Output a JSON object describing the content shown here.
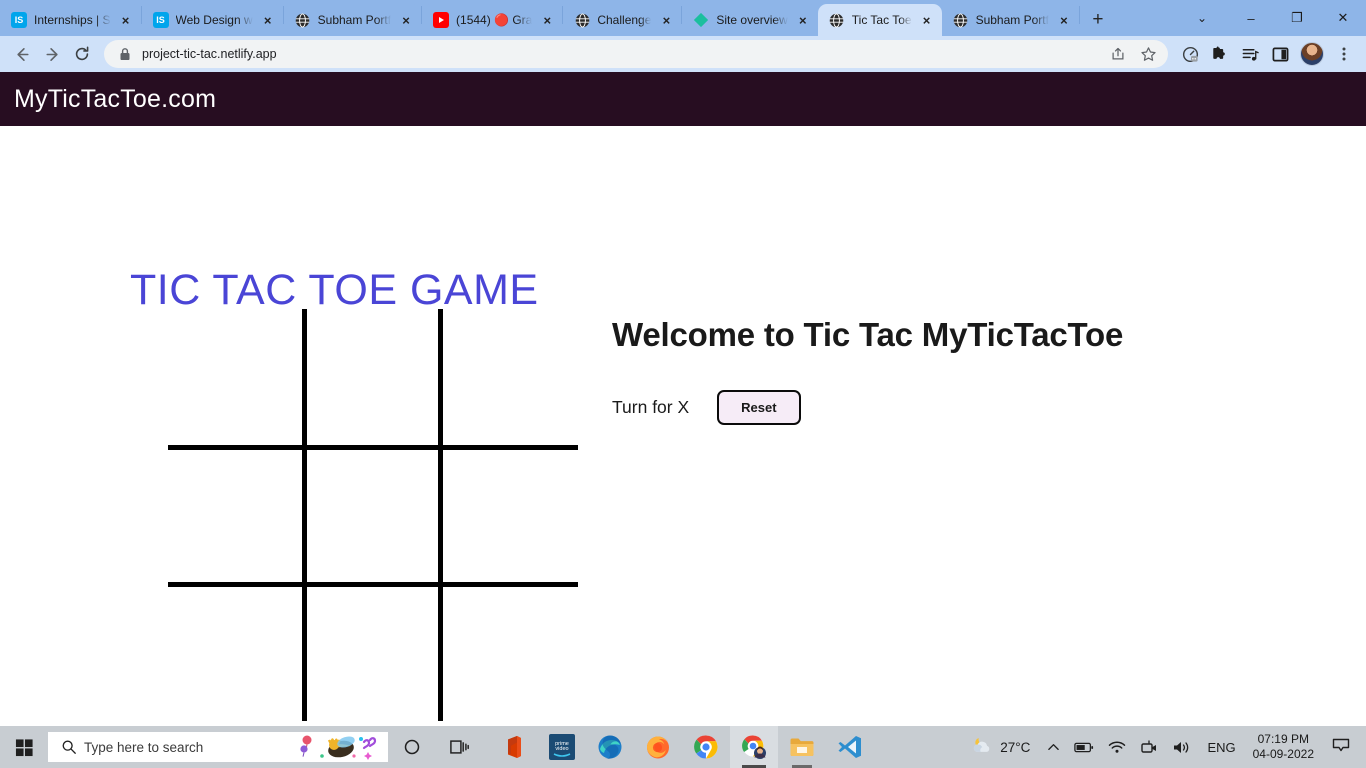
{
  "browser": {
    "tabs": [
      {
        "title": "Internships | S",
        "favicon": "internshala-icon",
        "active": false,
        "close_label": "×"
      },
      {
        "title": "Web Design w",
        "favicon": "internshala-icon",
        "active": false,
        "close_label": "×"
      },
      {
        "title": "Subham Portf",
        "favicon": "globe-icon",
        "active": false,
        "close_label": "×"
      },
      {
        "title": "(1544) 🔴 Gra",
        "favicon": "youtube-icon",
        "active": false,
        "close_label": "×"
      },
      {
        "title": "Challenge",
        "favicon": "globe-icon",
        "active": false,
        "close_label": "×"
      },
      {
        "title": "Site overview",
        "favicon": "netlify-diamond-icon",
        "active": false,
        "close_label": "×"
      },
      {
        "title": "Tic Tac Toe",
        "favicon": "globe-icon",
        "active": true,
        "close_label": "×"
      },
      {
        "title": "Subham Portf",
        "favicon": "globe-icon",
        "active": false,
        "close_label": "×"
      }
    ],
    "new_tab_label": "+",
    "window_controls": {
      "caret": "⌄",
      "minimize": "–",
      "maximize": "❐",
      "close": "✕"
    },
    "toolbar": {
      "back": "back-arrow",
      "forward": "forward-arrow",
      "reload": "reload-arrow",
      "url": "project-tic-tac.netlify.app",
      "security": "lock-icon",
      "share": "share-icon",
      "bookmark": "star-icon",
      "performance": "speedometer-icon",
      "extensions": "puzzle-icon",
      "media": "media-playlist-icon",
      "sidebar": "sidebar-icon",
      "profile": "avatar-icon",
      "menu": "three-dot-menu"
    }
  },
  "page": {
    "brand": "MyTicTacToe.com",
    "game_title": "TIC TAC TOE GAME",
    "welcome": "Welcome to Tic Tac MyTicTacToe",
    "turn_text": "Turn for X",
    "reset_label": "Reset",
    "colors": {
      "navbar": "#270d21",
      "title": "#4a45d6",
      "reset_bg": "#f6ecf7",
      "board_line": "#000000"
    },
    "board": {
      "cells": [
        "",
        "",
        "",
        "",
        "",
        "",
        "",
        "",
        ""
      ]
    }
  },
  "taskbar": {
    "start": "windows-start-icon",
    "search_placeholder": "Type here to search",
    "cortana": "cortana-icon",
    "task_view": "task-view-icon",
    "apps": [
      {
        "name": "office-icon",
        "state": "idle"
      },
      {
        "name": "prime-video-icon",
        "state": "idle"
      },
      {
        "name": "edge-icon",
        "state": "idle"
      },
      {
        "name": "firefox-icon",
        "state": "idle"
      },
      {
        "name": "chrome-icon",
        "state": "idle"
      },
      {
        "name": "chrome-profile-icon",
        "state": "active"
      },
      {
        "name": "file-explorer-icon",
        "state": "running"
      },
      {
        "name": "vscode-icon",
        "state": "idle"
      }
    ],
    "tray": {
      "weather_icon": "partly-cloudy-night-icon",
      "temperature": "27°C",
      "show_hidden": "chevron-up-icon",
      "battery": "battery-icon",
      "network": "wifi-icon",
      "camera": "camera-icon",
      "volume": "volume-icon",
      "language": "ENG",
      "time": "07:19 PM",
      "date": "04-09-2022",
      "notifications": "notification-icon"
    }
  }
}
